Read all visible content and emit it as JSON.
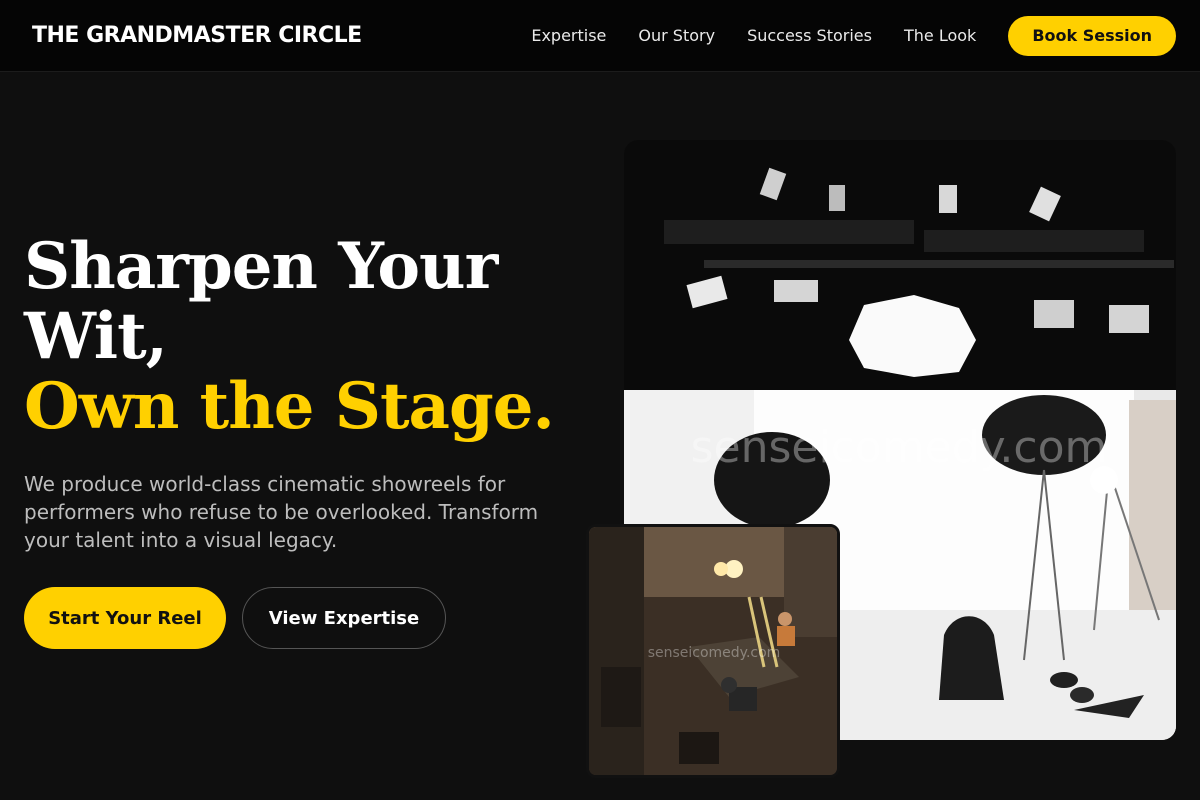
{
  "nav": {
    "brand": "THE GRANDMASTER CIRCLE",
    "links": [
      "Expertise",
      "Our Story",
      "Success Stories",
      "The Look"
    ],
    "cta": "Book Session"
  },
  "hero": {
    "headline_line1": "Sharpen Your",
    "headline_line2": "Wit,",
    "headline_accent": "Own the Stage.",
    "subtitle": "We produce world-class cinematic showreels for performers who refuse to be overlooked. Transform your talent into a visual legacy.",
    "primary_cta": "Start Your Reel",
    "secondary_cta": "View Expertise"
  },
  "images": {
    "main_watermark": "senseicomedy.com",
    "small_watermark": "senseicomedy.com"
  },
  "colors": {
    "accent": "#ffd000",
    "background": "#0f0f0f",
    "nav_background": "#050505"
  }
}
